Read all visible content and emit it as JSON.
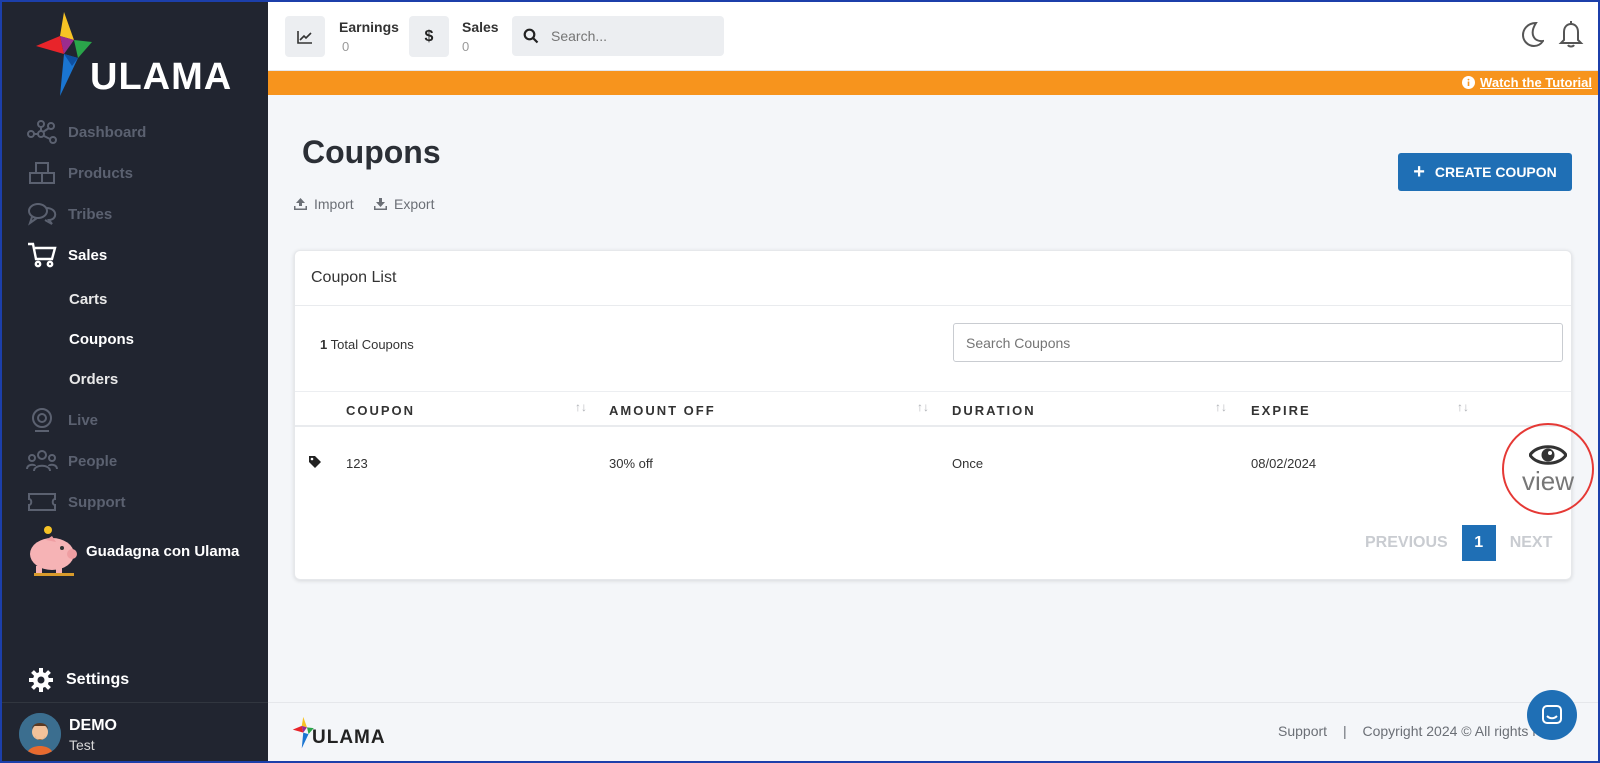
{
  "app": {
    "brand": "ULAMA"
  },
  "header": {
    "earnings_label": "Earnings",
    "earnings_value": "0",
    "sales_label": "Sales",
    "sales_value": "0",
    "search_placeholder": "Search..."
  },
  "banner": {
    "tutorial_label": "Watch the Tutorial",
    "bg_color": "#f7941d"
  },
  "sidebar": {
    "items": [
      {
        "label": "Dashboard",
        "icon": "network-icon"
      },
      {
        "label": "Products",
        "icon": "boxes-icon"
      },
      {
        "label": "Tribes",
        "icon": "chat-bubbles-icon"
      },
      {
        "label": "Sales",
        "icon": "cart-icon",
        "active": true
      },
      {
        "label": "Live",
        "icon": "webcam-icon"
      },
      {
        "label": "People",
        "icon": "people-icon"
      },
      {
        "label": "Support",
        "icon": "ticket-icon"
      }
    ],
    "sales_sub": [
      "Carts",
      "Coupons",
      "Orders"
    ],
    "earn_label": "Guadagna con Ulama",
    "settings_label": "Settings",
    "user": {
      "name": "DEMO",
      "role": "Test"
    }
  },
  "main": {
    "title": "Coupons",
    "import_label": "Import",
    "export_label": "Export",
    "create_label": "CREATE COUPON",
    "card_title": "Coupon List",
    "total_count": "1",
    "total_suffix": "Total Coupons",
    "search_placeholder": "Search Coupons",
    "columns": [
      "COUPON",
      "AMOUNT OFF",
      "DURATION",
      "EXPIRE"
    ],
    "rows": [
      {
        "coupon": "123",
        "amount_off": "30% off",
        "duration": "Once",
        "expire": "08/02/2024"
      }
    ],
    "view_label": "view",
    "pager": {
      "prev": "PREVIOUS",
      "page": "1",
      "next": "NEXT"
    }
  },
  "footer": {
    "brand": "ULAMA",
    "support_label": "Support",
    "separator": "|",
    "copyright": "Copyright 2024 © All rights res"
  },
  "colors": {
    "accent": "#1f6fb5",
    "sidebar_bg": "#212530"
  }
}
